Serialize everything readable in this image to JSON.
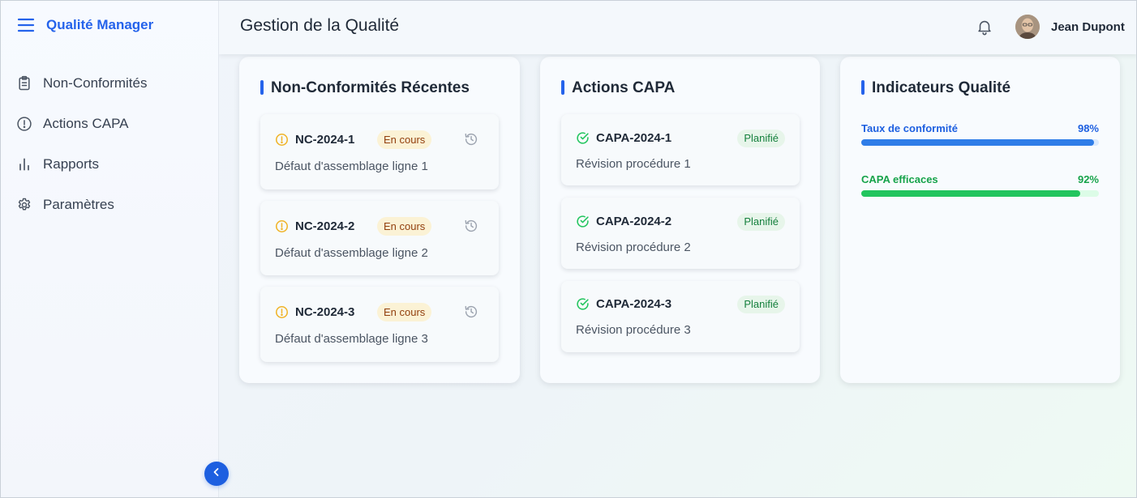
{
  "app": {
    "brand": "Qualité Manager"
  },
  "sidebar": {
    "items": [
      {
        "label": "Non-Conformités",
        "icon": "clipboard-icon"
      },
      {
        "label": "Actions CAPA",
        "icon": "alert-circle-icon"
      },
      {
        "label": "Rapports",
        "icon": "bar-chart-icon"
      },
      {
        "label": "Paramètres",
        "icon": "gear-icon"
      }
    ]
  },
  "header": {
    "title": "Gestion de la Qualité",
    "user_name": "Jean Dupont"
  },
  "panels": {
    "nc": {
      "title": "Non-Conformités Récentes",
      "items": [
        {
          "code": "NC-2024-1",
          "status": "En cours",
          "description": "Défaut d'assemblage ligne 1"
        },
        {
          "code": "NC-2024-2",
          "status": "En cours",
          "description": "Défaut d'assemblage ligne 2"
        },
        {
          "code": "NC-2024-3",
          "status": "En cours",
          "description": "Défaut d'assemblage ligne 3"
        }
      ]
    },
    "capa": {
      "title": "Actions CAPA",
      "items": [
        {
          "code": "CAPA-2024-1",
          "status": "Planifié",
          "description": "Révision procédure 1"
        },
        {
          "code": "CAPA-2024-2",
          "status": "Planifié",
          "description": "Révision procédure 2"
        },
        {
          "code": "CAPA-2024-3",
          "status": "Planifié",
          "description": "Révision procédure 3"
        }
      ]
    },
    "kpi": {
      "title": "Indicateurs Qualité",
      "metrics": [
        {
          "label": "Taux de conformité",
          "value": "98%",
          "fraction": 0.98,
          "color": "#2f7de8",
          "track_color": "#dbeafe",
          "label_color": "#1d5fe0"
        },
        {
          "label": "CAPA efficaces",
          "value": "92%",
          "fraction": 0.92,
          "color": "#22c55e",
          "track_color": "#dcfce7",
          "label_color": "#16a34a"
        }
      ]
    }
  },
  "colors": {
    "accent": "#2563eb",
    "warning": "#f0b429",
    "success": "#22c55e"
  }
}
